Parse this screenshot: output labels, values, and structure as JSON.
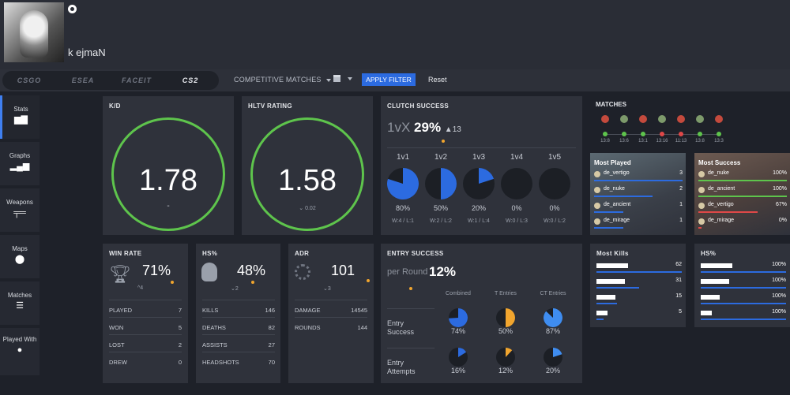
{
  "profile": {
    "username": "k ejmaN"
  },
  "platforms": [
    "CSGO",
    "ESEA",
    "FACEIT",
    "CS2"
  ],
  "toolbar": {
    "mode": "COMPETITIVE MATCHES",
    "apply": "APPLY FILTER",
    "reset": "Reset"
  },
  "sidebar": [
    {
      "label": "Stats",
      "icon": "bar-chart-icon"
    },
    {
      "label": "Graphs",
      "icon": "signal-bars-icon"
    },
    {
      "label": "Weapons",
      "icon": "rifle-icon"
    },
    {
      "label": "Maps",
      "icon": "map-pin-icon"
    },
    {
      "label": "Matches",
      "icon": "list-icon"
    },
    {
      "label": "Played With",
      "label2": "With",
      "icon": "user-icon"
    }
  ],
  "kd": {
    "title": "K/D",
    "value": "1.78",
    "delta": "-"
  },
  "hltv": {
    "title": "HLTV RATING",
    "value": "1.58",
    "delta": "0.02"
  },
  "clutch": {
    "title": "CLUTCH SUCCESS",
    "label": "1vX",
    "pct": "29%",
    "delta": "13",
    "cols": [
      {
        "h": "1v1",
        "p": "80%",
        "r": "W:4 / L:1",
        "v": 0.8
      },
      {
        "h": "1v2",
        "p": "50%",
        "r": "W:2 / L:2",
        "v": 0.5
      },
      {
        "h": "1v3",
        "p": "20%",
        "r": "W:1 / L:4",
        "v": 0.2
      },
      {
        "h": "1v4",
        "p": "0%",
        "r": "W:0 / L:3",
        "v": 0
      },
      {
        "h": "1v5",
        "p": "0%",
        "r": "W:0 / L:2",
        "v": 0
      }
    ]
  },
  "matches": {
    "title": "MATCHES",
    "items": [
      {
        "score": "13:8",
        "win": true
      },
      {
        "score": "13:6",
        "win": true
      },
      {
        "score": "13:1",
        "win": true
      },
      {
        "score": "13:16",
        "win": false
      },
      {
        "score": "11:13",
        "win": false
      },
      {
        "score": "13:8",
        "win": true
      },
      {
        "score": "13:3",
        "win": true
      }
    ]
  },
  "most_played": {
    "title": "Most Played",
    "rows": [
      {
        "map": "de_vertigo",
        "val": "3",
        "frac": 1.0,
        "color": "#2c6be0"
      },
      {
        "map": "de_nuke",
        "val": "2",
        "frac": 0.66,
        "color": "#2c6be0"
      },
      {
        "map": "de_ancient",
        "val": "1",
        "frac": 0.33,
        "color": "#2c6be0"
      },
      {
        "map": "de_mirage",
        "val": "1",
        "frac": 0.33,
        "color": "#2c6be0"
      }
    ]
  },
  "most_success": {
    "title": "Most Success",
    "rows": [
      {
        "map": "de_nuke",
        "val": "100%",
        "frac": 1.0,
        "color": "#5ec44c"
      },
      {
        "map": "de_ancient",
        "val": "100%",
        "frac": 1.0,
        "color": "#5ec44c"
      },
      {
        "map": "de_vertigo",
        "val": "67%",
        "frac": 0.67,
        "color": "#e04848"
      },
      {
        "map": "de_mirage",
        "val": "0%",
        "frac": 0.04,
        "color": "#e04848"
      }
    ]
  },
  "winrate": {
    "title": "WIN RATE",
    "value": "71%",
    "delta": "4",
    "rows": [
      {
        "k": "PLAYED",
        "v": "7"
      },
      {
        "k": "WON",
        "v": "5"
      },
      {
        "k": "LOST",
        "v": "2"
      },
      {
        "k": "DREW",
        "v": "0"
      }
    ]
  },
  "hs": {
    "title": "HS%",
    "value": "48%",
    "delta": "2",
    "rows": [
      {
        "k": "KILLS",
        "v": "146"
      },
      {
        "k": "DEATHS",
        "v": "82"
      },
      {
        "k": "ASSISTS",
        "v": "27"
      },
      {
        "k": "HEADSHOTS",
        "v": "70"
      }
    ]
  },
  "adr": {
    "title": "ADR",
    "value": "101",
    "delta": "3",
    "rows": [
      {
        "k": "DAMAGE",
        "v": "14545"
      },
      {
        "k": "ROUNDS",
        "v": "144"
      }
    ]
  },
  "entry": {
    "title": "ENTRY SUCCESS",
    "per_round_label": "per Round",
    "per_round": "12%",
    "cols": [
      "Combined",
      "T Entries",
      "CT Entries"
    ],
    "rows": [
      {
        "label1": "Entry",
        "label2": "Success",
        "pcts": [
          "74%",
          "50%",
          "87%"
        ],
        "vals": [
          0.74,
          0.5,
          0.87
        ],
        "colors": [
          "#2c6be0",
          "#f1a52e",
          "#3f8df0"
        ]
      },
      {
        "label1": "Entry",
        "label2": "Attempts",
        "pcts": [
          "16%",
          "12%",
          "20%"
        ],
        "vals": [
          0.16,
          0.12,
          0.2
        ],
        "colors": [
          "#2c6be0",
          "#f1a52e",
          "#3f8df0"
        ]
      }
    ]
  },
  "most_kills": {
    "title": "Most Kills",
    "rows": [
      {
        "v": "62",
        "frac": 1.0
      },
      {
        "v": "31",
        "frac": 0.5
      },
      {
        "v": "15",
        "frac": 0.24
      },
      {
        "v": "5",
        "frac": 0.08
      }
    ]
  },
  "hs_weapons": {
    "title": "HS%",
    "rows": [
      {
        "v": "100%",
        "frac": 1.0
      },
      {
        "v": "100%",
        "frac": 1.0
      },
      {
        "v": "100%",
        "frac": 1.0
      },
      {
        "v": "100%",
        "frac": 1.0
      }
    ]
  }
}
